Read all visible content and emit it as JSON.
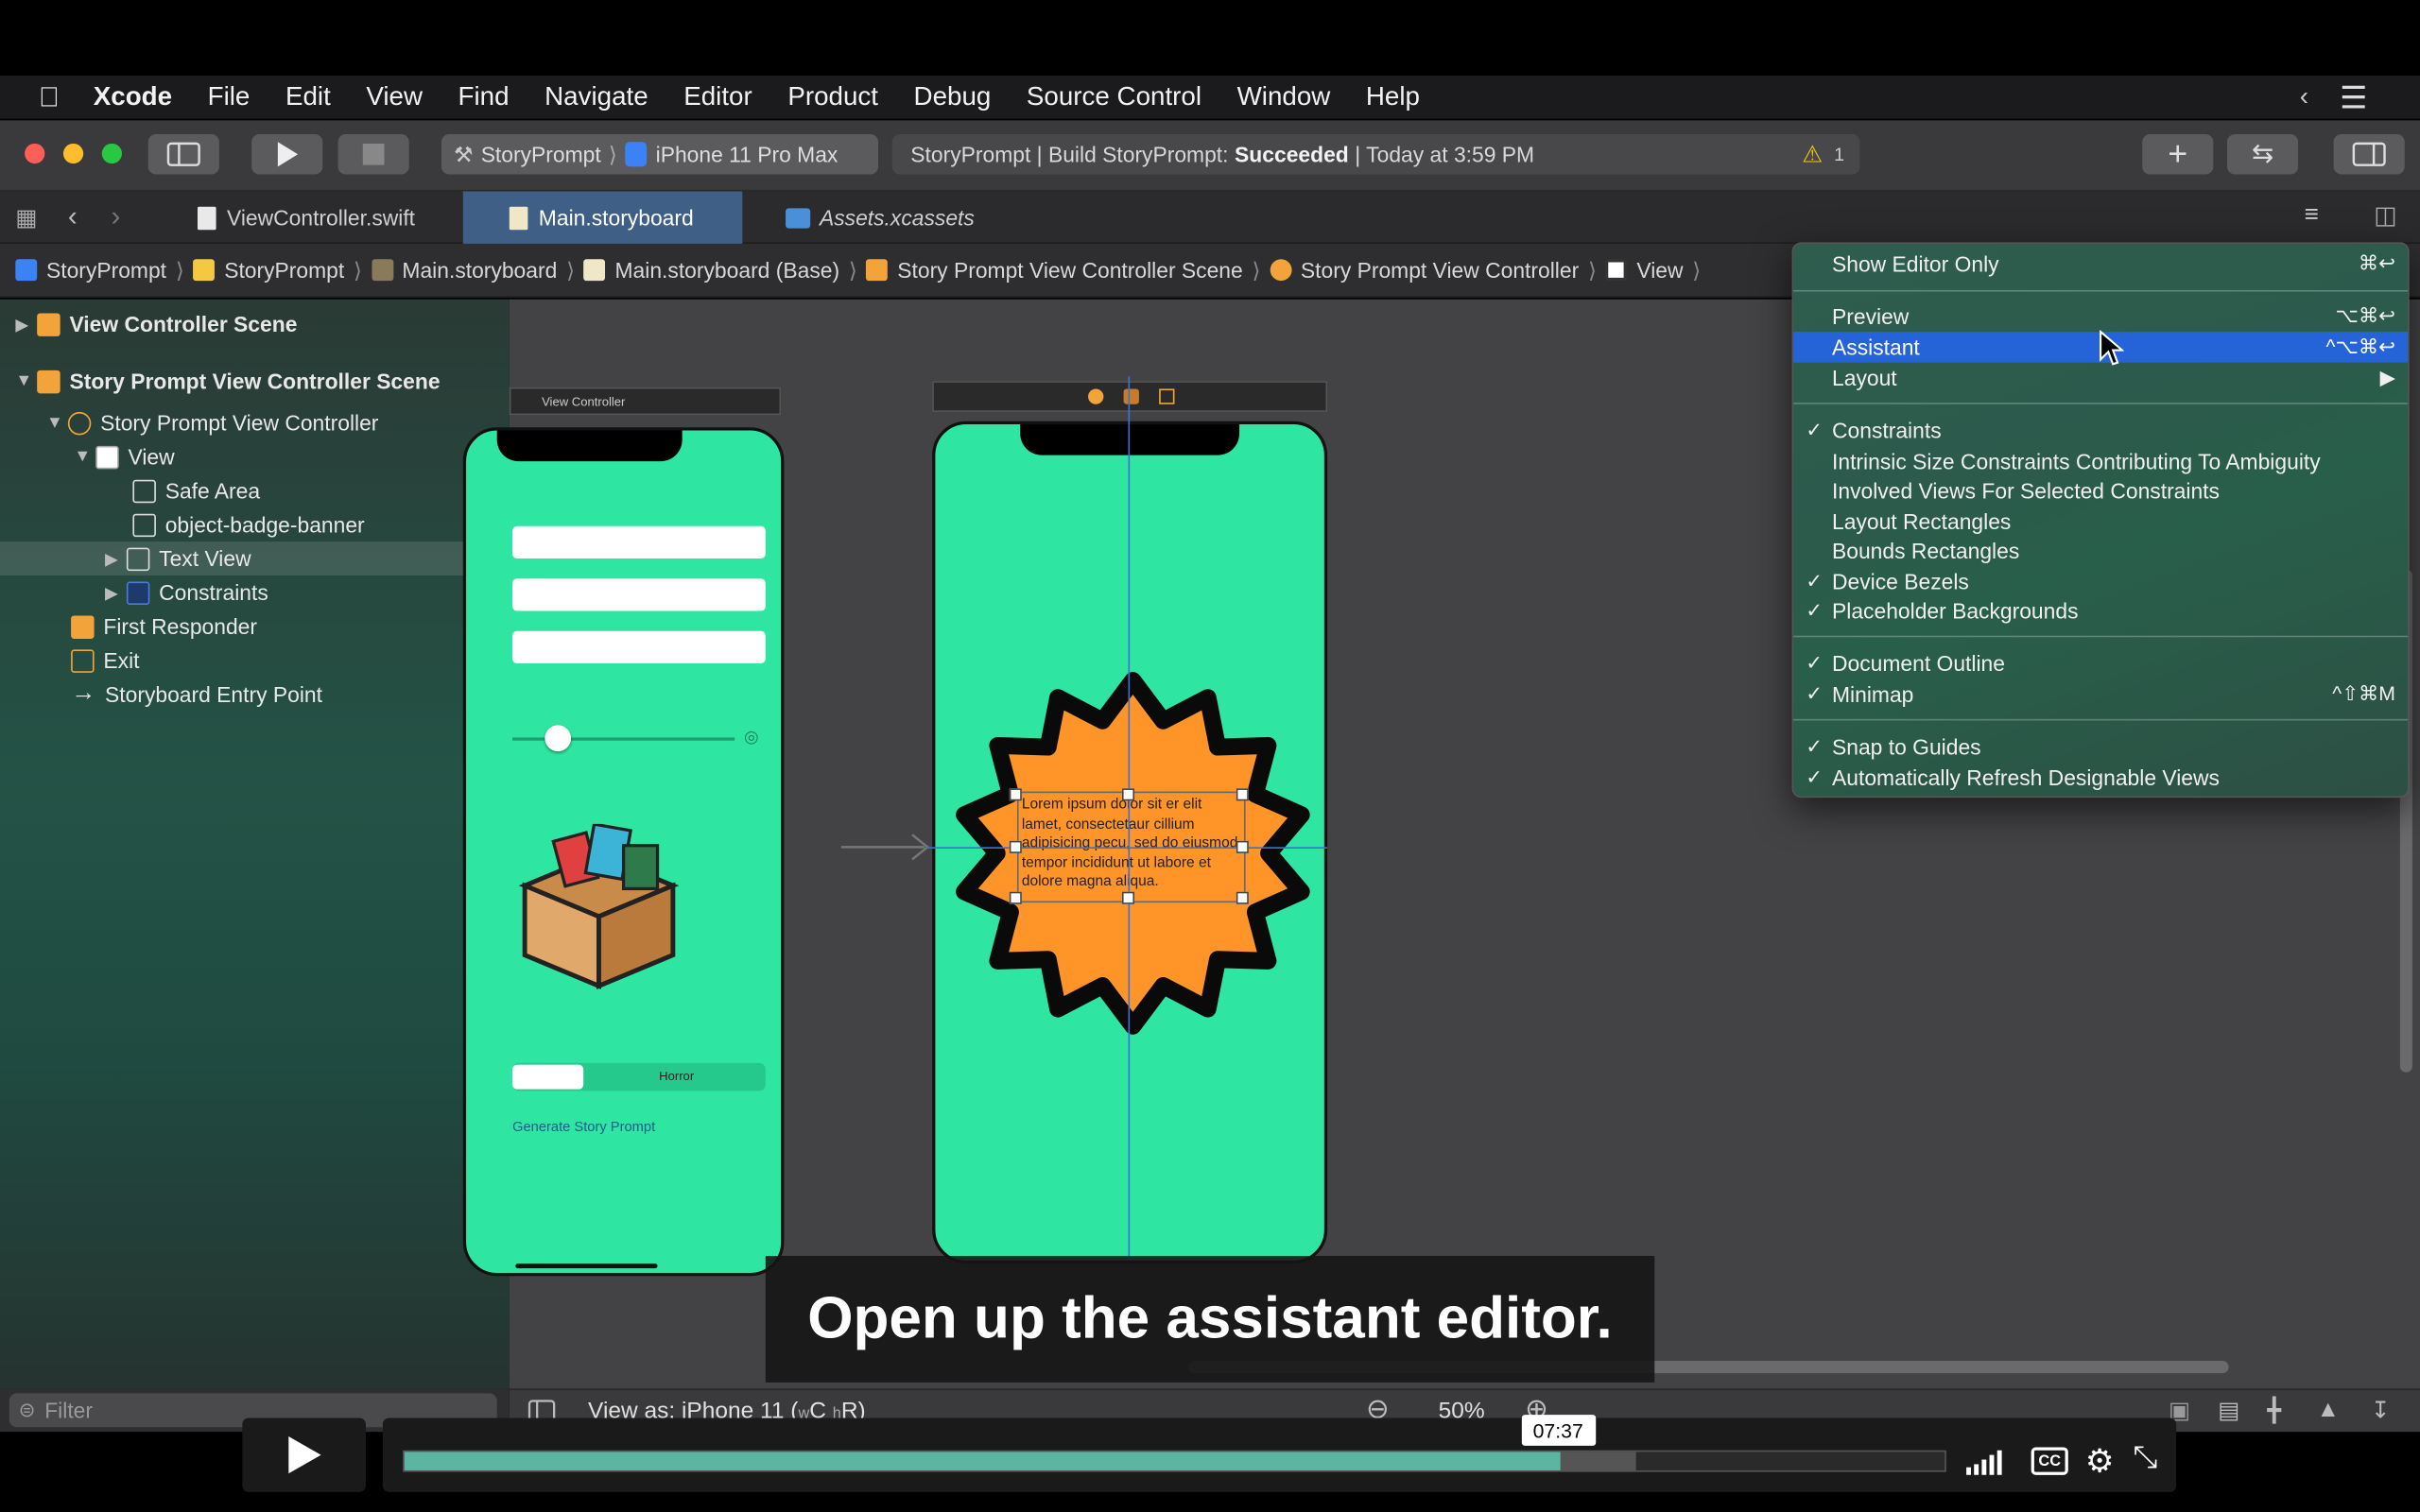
{
  "menubar": {
    "items": [
      "Xcode",
      "File",
      "Edit",
      "View",
      "Find",
      "Navigate",
      "Editor",
      "Product",
      "Debug",
      "Source Control",
      "Window",
      "Help"
    ]
  },
  "toolbar": {
    "scheme": "StoryPrompt",
    "device": "iPhone 11 Pro Max",
    "activity_prefix": "StoryPrompt | Build StoryPrompt: ",
    "activity_status": "Succeeded",
    "activity_suffix": " | Today at 3:59 PM",
    "warning_count": "1"
  },
  "tabs": [
    {
      "label": "ViewController.swift"
    },
    {
      "label": "Main.storyboard"
    },
    {
      "label": "Assets.xcassets"
    }
  ],
  "jumpbar": [
    "StoryPrompt",
    "StoryPrompt",
    "Main.storyboard",
    "Main.storyboard (Base)",
    "Story Prompt View Controller Scene",
    "Story Prompt View Controller",
    "View"
  ],
  "navigator": {
    "rows": [
      "View Controller Scene",
      "Story Prompt View Controller Scene",
      "Story Prompt View Controller",
      "View",
      "Safe Area",
      "object-badge-banner",
      "Text View",
      "Constraints",
      "First Responder",
      "Exit",
      "Storyboard Entry Point"
    ],
    "filter_placeholder": "Filter"
  },
  "canvas": {
    "left_scene_title": "View Controller",
    "segment_label": "Horror",
    "generate_label": "Generate Story Prompt",
    "lorem": "Lorem ipsum dolor sit er elit lamet, consectetaur cillium adipisicing pecu, sed do eiusmod tempor incididunt ut labore et dolore magna aliqua."
  },
  "bottombar": {
    "view_as": "View as: iPhone 11 (",
    "w_small": "w",
    "c": "C ",
    "h_small": "h",
    "r": "R)",
    "zoom": "50%"
  },
  "menu": {
    "items": [
      {
        "label": "Show Editor Only",
        "shortcut": "⌘↩"
      },
      {
        "label": "Preview",
        "shortcut": "⌥⌘↩"
      },
      {
        "label": "Assistant",
        "shortcut": "^⌥⌘↩"
      },
      {
        "label": "Layout",
        "shortcut": "▶"
      },
      {
        "label": "Constraints",
        "shortcut": ""
      },
      {
        "label": "Intrinsic Size Constraints Contributing To Ambiguity",
        "shortcut": ""
      },
      {
        "label": "Involved Views For Selected Constraints",
        "shortcut": ""
      },
      {
        "label": "Layout Rectangles",
        "shortcut": ""
      },
      {
        "label": "Bounds Rectangles",
        "shortcut": ""
      },
      {
        "label": "Device Bezels",
        "shortcut": ""
      },
      {
        "label": "Placeholder Backgrounds",
        "shortcut": ""
      },
      {
        "label": "Document Outline",
        "shortcut": ""
      },
      {
        "label": "Minimap",
        "shortcut": "^⇧⌘M"
      },
      {
        "label": "Snap to Guides",
        "shortcut": ""
      },
      {
        "label": "Automatically Refresh Designable Views",
        "shortcut": ""
      }
    ],
    "check": "✓"
  },
  "video": {
    "subtitle": "Open up the assistant editor.",
    "time": "07:37",
    "progress": 0.75,
    "buffered": 0.8,
    "cc": "CC"
  },
  "colors": {
    "highlight": "#2563d9",
    "phone_green": "#2ee6a2",
    "badge_orange": "#ff9428",
    "progress": "#5ab6a0"
  }
}
